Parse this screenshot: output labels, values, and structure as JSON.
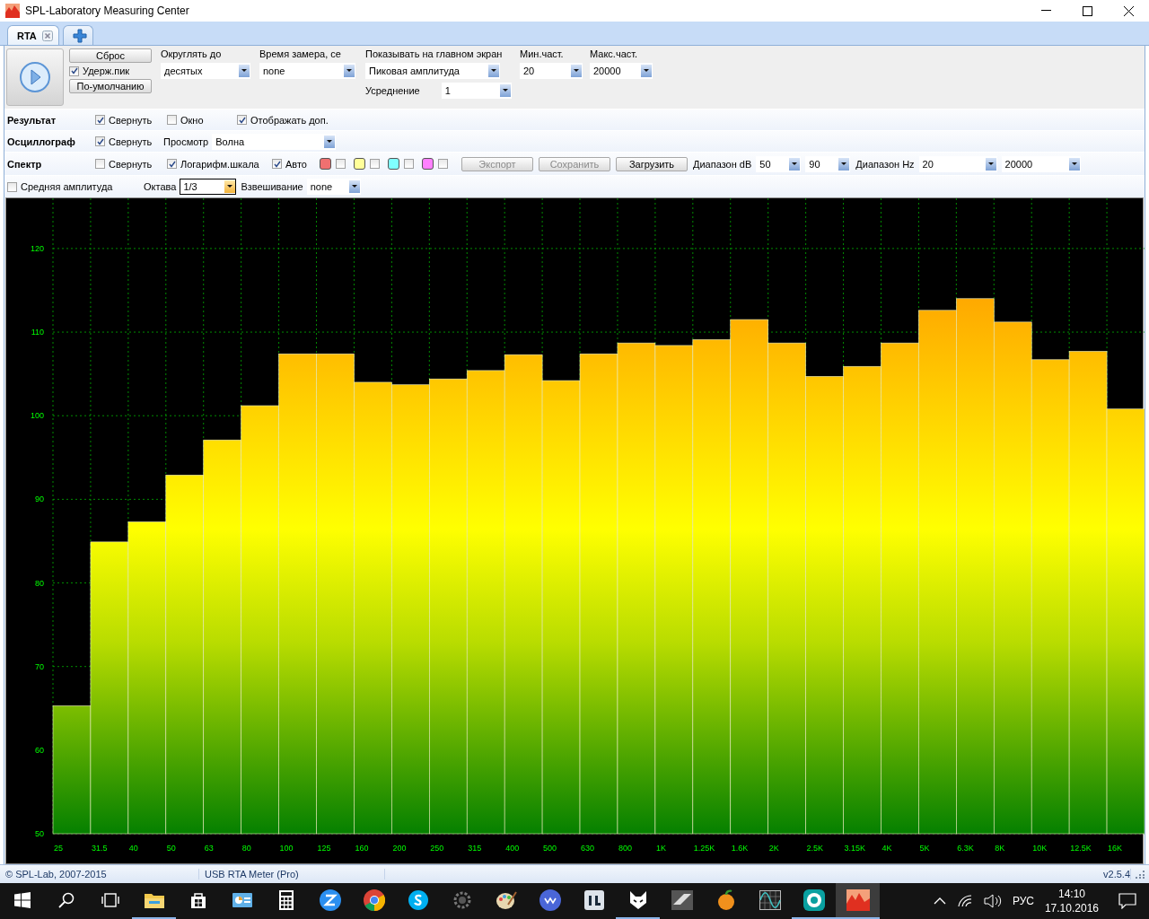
{
  "window": {
    "title": "SPL-Laboratory Measuring Center"
  },
  "tabs": [
    {
      "kind": "tab",
      "label": "RTA",
      "selected": true
    },
    {
      "kind": "add",
      "selected": false
    }
  ],
  "toolbar": {
    "reset_button": "Сброс",
    "hold_peak": {
      "label": "Удерж.пик",
      "checked": true
    },
    "default_button": "По-умолчанию",
    "rounding": {
      "label": "Округлять до",
      "value": "десятых"
    },
    "measure_time": {
      "label": "Время замера, се",
      "value": "none"
    },
    "show_main": {
      "label": "Показывать на главном экран",
      "value": "Пиковая амплитуда"
    },
    "averaging": {
      "label": "Усреднение",
      "value": "1"
    },
    "min_freq": {
      "label": "Мин.част.",
      "value": "20"
    },
    "max_freq": {
      "label": "Макс.част.",
      "value": "20000"
    }
  },
  "result": {
    "title": "Результат",
    "options": [
      {
        "label": "Свернуть",
        "checked": true
      },
      {
        "label": "Окно",
        "checked": false
      },
      {
        "label": "Отображать доп.",
        "checked": true
      }
    ]
  },
  "oscillograph": {
    "title": "Осциллограф",
    "collapse": {
      "label": "Свернуть",
      "checked": true
    },
    "view": {
      "label": "Просмотр",
      "value": "Волна"
    }
  },
  "spectrum": {
    "title": "Спектр",
    "options": [
      {
        "label": "Свернуть",
        "checked": false
      },
      {
        "label": "Логарифм.шкала",
        "checked": true
      },
      {
        "label": "Авто",
        "checked": true
      }
    ],
    "traces": [
      {
        "color": "#f07070",
        "checked": false
      },
      {
        "color": "#ffff99",
        "checked": false
      },
      {
        "color": "#80ffff",
        "checked": false
      },
      {
        "color": "#ff80ff",
        "checked": false
      }
    ],
    "buttons": [
      {
        "label": "Экспорт",
        "disabled": true
      },
      {
        "label": "Сохранить",
        "disabled": true
      },
      {
        "label": "Загрузить",
        "disabled": false
      }
    ],
    "db_range": {
      "label": "Диапазон dB",
      "from": "50",
      "to": "90"
    },
    "hz_range": {
      "label": "Диапазон Hz",
      "from": "20",
      "to": "20000"
    }
  },
  "spectrum_options": {
    "average": {
      "label": "Средняя амплитуда",
      "checked": false
    },
    "octave": {
      "label": "Октава",
      "value": "1/3"
    },
    "weighting": {
      "label": "Взвешивание",
      "value": "none"
    }
  },
  "chart": {
    "chart_data": {
      "type": "bar",
      "categories": [
        "25",
        "31.5",
        "40",
        "50",
        "63",
        "80",
        "100",
        "125",
        "160",
        "200",
        "250",
        "315",
        "400",
        "500",
        "630",
        "800",
        "1K",
        "1.25K",
        "1.6K",
        "2K",
        "2.5K",
        "3.15K",
        "4K",
        "5K",
        "6.3K",
        "8K",
        "10K",
        "12.5K",
        "16K"
      ],
      "values": [
        65.3,
        84.9,
        87.3,
        92.9,
        97.1,
        101.2,
        107.4,
        107.4,
        104.0,
        103.7,
        104.4,
        105.4,
        107.3,
        104.2,
        107.4,
        108.7,
        108.4,
        109.1,
        111.5,
        108.7,
        104.7,
        105.9,
        108.7,
        112.6,
        114.0,
        111.2,
        106.7,
        107.7,
        100.8
      ],
      "ylim": [
        50,
        126
      ],
      "grid": true,
      "yticks": [
        50,
        60,
        70,
        80,
        90,
        100,
        110,
        120
      ]
    }
  },
  "status_bar": [
    "© SPL-Lab, 2007-2015",
    "USB RTA Meter (Pro)",
    "v2.5.4"
  ],
  "taskbar": {
    "items": [
      {
        "kind": "start",
        "running": false,
        "selected": false
      },
      {
        "kind": "search",
        "running": false,
        "selected": false
      },
      {
        "kind": "taskview",
        "running": false,
        "selected": false
      },
      {
        "kind": "folder",
        "running": true,
        "selected": false
      },
      {
        "kind": "store",
        "running": false,
        "selected": false
      },
      {
        "kind": "card",
        "running": false,
        "selected": false
      },
      {
        "kind": "calculator",
        "running": false,
        "selected": false
      },
      {
        "kind": "bluecircle",
        "running": false,
        "selected": false
      },
      {
        "kind": "browser",
        "running": false,
        "selected": false
      },
      {
        "kind": "chat",
        "running": false,
        "selected": false
      },
      {
        "kind": "gear",
        "running": false,
        "selected": false
      },
      {
        "kind": "palette",
        "running": false,
        "selected": false
      },
      {
        "kind": "purplecircle",
        "running": false,
        "selected": false
      },
      {
        "kind": "tile",
        "running": false,
        "selected": false
      },
      {
        "kind": "cat",
        "running": true,
        "selected": false
      },
      {
        "kind": "steel",
        "running": false,
        "selected": false
      },
      {
        "kind": "fruit",
        "running": false,
        "selected": false
      },
      {
        "kind": "scope",
        "running": false,
        "selected": false
      },
      {
        "kind": "letter",
        "running": true,
        "selected": false
      },
      {
        "kind": "spl",
        "running": true,
        "selected": true
      }
    ],
    "language": "РУС",
    "time": "14:10",
    "date": "17.10.2016"
  }
}
